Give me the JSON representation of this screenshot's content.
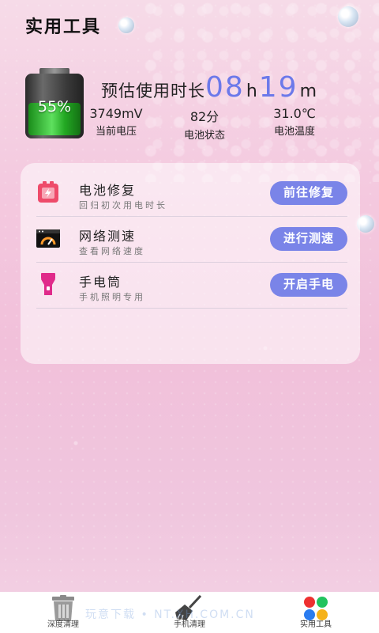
{
  "header": {
    "title": "实用工具"
  },
  "battery": {
    "percent": "55%",
    "level": 0.55,
    "estimate_label": "预估使用时长",
    "hours": "08",
    "hours_unit": "h",
    "minutes": "19",
    "minutes_unit": "m",
    "stats": [
      {
        "value": "3749mV",
        "label": "当前电压"
      },
      {
        "value": "82分",
        "label": "电池状态"
      },
      {
        "value": "31.0℃",
        "label": "电池温度"
      }
    ]
  },
  "tools": [
    {
      "name": "电池修复",
      "desc": "回归初次用电时长",
      "button": "前往修复",
      "icon": "battery-repair-icon"
    },
    {
      "name": "网络测速",
      "desc": "查看网络速度",
      "button": "进行测速",
      "icon": "speedometer-icon"
    },
    {
      "name": "手电筒",
      "desc": "手机照明专用",
      "button": "开启手电",
      "icon": "flashlight-icon"
    }
  ],
  "nav": {
    "items": [
      {
        "label": "深度清理",
        "icon": "trash-can-icon"
      },
      {
        "label": "手机清理",
        "icon": "broom-icon"
      },
      {
        "label": "实用工具",
        "icon": "tools-grid-icon"
      }
    ]
  },
  "watermark": "玩意下载 • NT.XH.COM.CN",
  "colors": {
    "accent": "#7a84e8",
    "time_digits": "#6c79ea",
    "icon_red": "#ee4b6a",
    "icon_magenta": "#e02a8a"
  }
}
